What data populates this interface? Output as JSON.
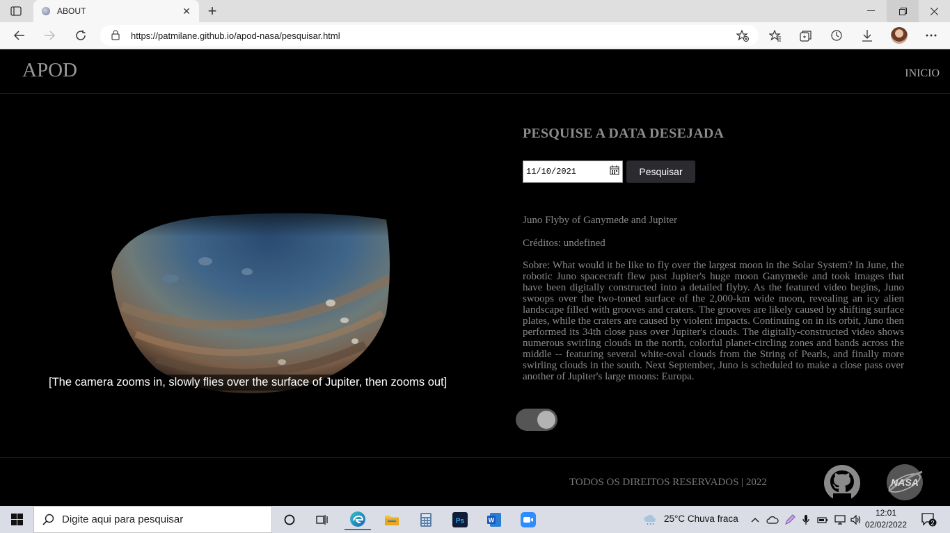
{
  "browser": {
    "tab_title": "ABOUT",
    "url": "https://patmilane.github.io/apod-nasa/pesquisar.html"
  },
  "site": {
    "logo": "APOD",
    "nav_inicio": "INICIO"
  },
  "media": {
    "caption": "[The camera zooms in, slowly flies over the surface of Jupiter, then zooms out]"
  },
  "search": {
    "heading": "PESQUISE A DATA DESEJADA",
    "date_value": "11/10/2021",
    "button_label": "Pesquisar"
  },
  "apod": {
    "title": "Juno Flyby of Ganymede and Jupiter",
    "credits": "Créditos: undefined",
    "about": "Sobre: What would it be like to fly over the largest moon in the Solar System? In June, the robotic Juno spacecraft flew past Jupiter's huge moon Ganymede and took images that have been digitally constructed into a detailed flyby. As the featured video begins, Juno swoops over the two-toned surface of the 2,000-km wide moon, revealing an icy alien landscape filled with grooves and craters. The grooves are likely caused by shifting surface plates, while the craters are caused by violent impacts. Continuing on in its orbit, Juno then performed its 34th close pass over Jupiter's clouds. The digitally-constructed video shows numerous swirling clouds in the north, colorful planet-circling zones and bands across the middle -- featuring several white-oval clouds from the String of Pearls, and finally more swirling clouds in the south. Next September, Juno is scheduled to make a close pass over another of Jupiter's large moons: Europa."
  },
  "footer": {
    "copyright": "TODOS OS DIREITOS RESERVADOS | 2022",
    "nasa_logo_text": "NASA"
  },
  "taskbar": {
    "search_placeholder": "Digite aqui para pesquisar",
    "weather": "25°C  Chuva fraca",
    "time": "12:01",
    "date": "02/02/2022",
    "notifications": "2"
  },
  "icons": [
    "tab-actions-icon",
    "close-icon",
    "plus-icon",
    "back-icon",
    "forward-icon",
    "refresh-icon",
    "lock-icon",
    "add-favorite-icon",
    "favorites-icon",
    "collections-icon",
    "history-icon",
    "download-icon",
    "more-icon",
    "calendar-icon",
    "github-icon",
    "nasa-logo",
    "windows-icon",
    "search-icon",
    "cortana-icon",
    "task-view-icon",
    "edge-icon",
    "file-explorer-icon",
    "calculator-icon",
    "photoshop-icon",
    "word-icon",
    "zoom-icon",
    "weather-icon",
    "chevron-up-icon",
    "onedrive-icon",
    "pen-icon",
    "microphone-icon",
    "battery-icon",
    "network-icon",
    "volume-icon",
    "notification-icon"
  ]
}
